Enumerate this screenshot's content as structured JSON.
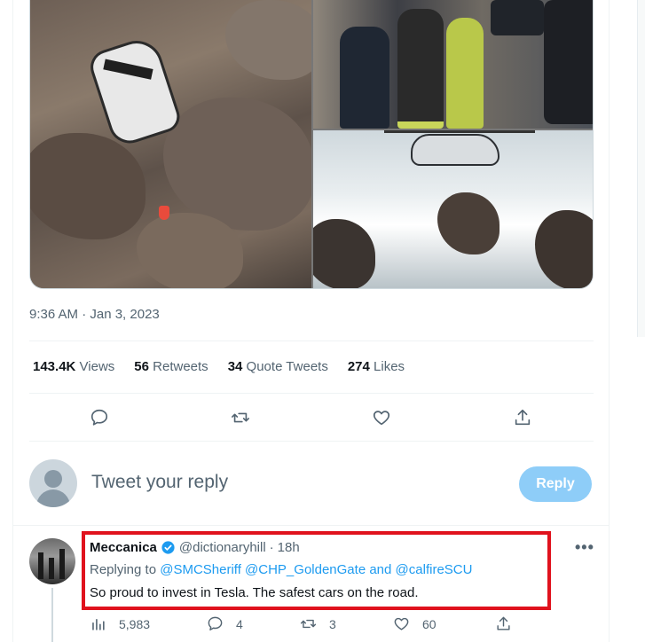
{
  "tweet": {
    "timestamp": "9:36 AM · Jan 3, 2023",
    "stats": [
      {
        "count": "143.4K",
        "label": "Views"
      },
      {
        "count": "56",
        "label": "Retweets"
      },
      {
        "count": "34",
        "label": "Quote Tweets"
      },
      {
        "count": "274",
        "label": "Likes"
      }
    ],
    "actions": [
      "reply-icon",
      "retweet-icon",
      "like-icon",
      "share-icon"
    ]
  },
  "compose": {
    "placeholder": "Tweet your reply",
    "button_label": "Reply",
    "button_color": "#8ecdf8"
  },
  "reply": {
    "name": "Meccanica",
    "handle": "@dictionaryhill",
    "separator": "·",
    "time": "18h",
    "replying_prefix": "Replying to",
    "mention_1": "@SMCSheriff",
    "mention_2": "@CHP_GoldenGate",
    "mention_and": "and",
    "mention_3": "@calfireSCU",
    "text": "So proud to invest in Tesla. The safest cars on the road.",
    "more": "•••",
    "metrics": {
      "views": "5,983",
      "replies": "4",
      "retweets": "3",
      "likes": "60"
    }
  },
  "colors": {
    "accent": "#1d9bf0",
    "highlight_border": "#e0121d",
    "muted_text": "#536471"
  }
}
